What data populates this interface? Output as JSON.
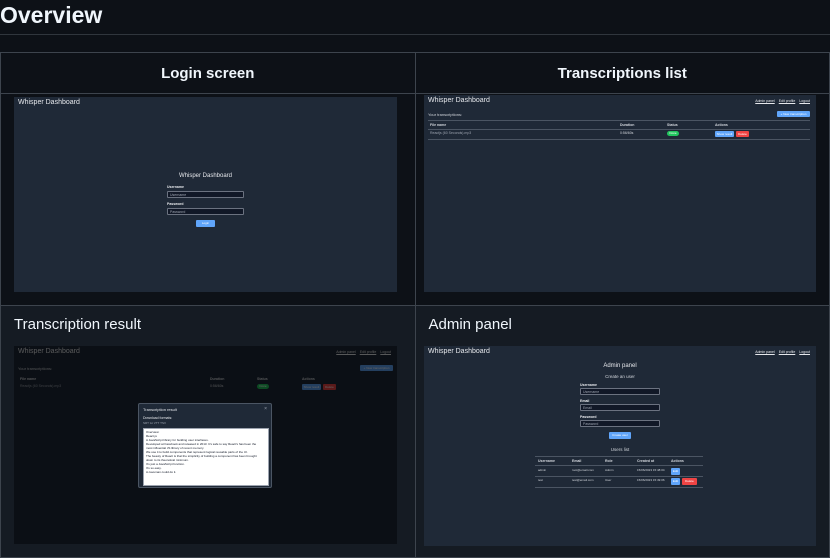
{
  "page_title": "Overview",
  "panels": [
    {
      "caption": "Login screen"
    },
    {
      "caption": "Transcriptions list"
    },
    {
      "caption": "Transcription result"
    },
    {
      "caption": "Admin panel"
    }
  ],
  "app": {
    "brand": "Whisper Dashboard",
    "nav": [
      "Admin panel",
      "Edit profile",
      "Logout"
    ]
  },
  "login": {
    "title": "Whisper Dashboard",
    "username_label": "Username",
    "username_placeholder": "Username",
    "password_label": "Password",
    "password_placeholder": "Password",
    "submit": "Login"
  },
  "list": {
    "heading": "Your transcriptions:",
    "new_button": "+ New transcription",
    "columns": [
      "File name",
      "Duration",
      "Status",
      "Actions"
    ],
    "rows": [
      {
        "file": "Reactjs (60 Seconds).mp3",
        "duration": "0:56/60s",
        "status": "Done",
        "actions": [
          "Show result",
          "Delete"
        ]
      }
    ]
  },
  "result": {
    "modal_title": "Transcription result",
    "close": "×",
    "download_label": "Download formats:",
    "formats": "SRT  txt  VTT  TSV",
    "body_label": "Overview:",
    "lines": [
      "React.js",
      "A JavaScript library for building user interfaces.",
      "Developed at Facebook and released in 2013. It's safe to say React's has been the",
      "most influential JS library of recent memory.",
      "We use it to build components that represent logical reusable parts of the UI.",
      "The beauty of React is that the simplicity of building a component has been brought",
      "down to its theoretical minimum.",
      "It's just a JavaScript function.",
      "It's so easy.",
      "A caveman could do it."
    ]
  },
  "admin": {
    "title": "Admin panel",
    "create_heading": "Create an user",
    "username_label": "Username",
    "username_placeholder": "Username",
    "email_label": "Email",
    "email_placeholder": "Email",
    "password_label": "Password",
    "password_placeholder": "Password",
    "create_button": "Create user",
    "users_heading": "Users list",
    "columns": [
      "Username",
      "Email",
      "Role",
      "Created at",
      "Actions"
    ],
    "users": [
      {
        "username": "admin",
        "email": "root@email.com",
        "role": "Admin",
        "created": "15/06/2023 15:48:04",
        "actions": [
          "Edit"
        ]
      },
      {
        "username": "test",
        "email": "test@email.com",
        "role": "User",
        "created": "15/06/2023 15:49:06",
        "actions": [
          "Edit",
          "Delete"
        ]
      }
    ]
  }
}
